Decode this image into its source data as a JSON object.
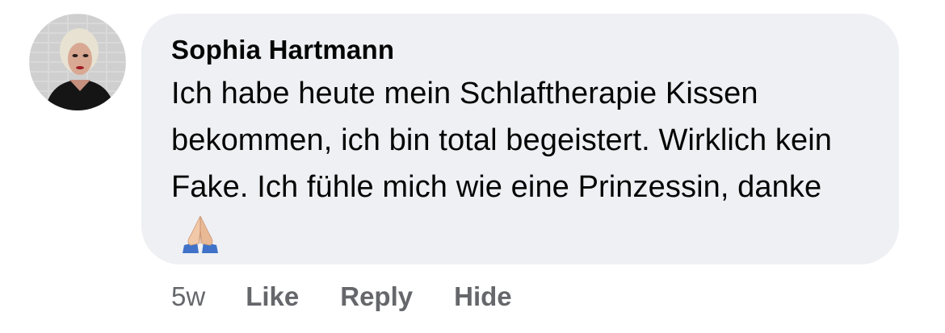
{
  "comment": {
    "author": "Sophia Hartmann",
    "text": "Ich habe heute mein Schlaftherapie Kissen bekommen, ich bin total begeistert. Wirklich kein Fake. Ich fühle mich wie eine Prinzessin, danke",
    "emoji": "folded-hands-icon",
    "timestamp": "5w",
    "actions": {
      "like": "Like",
      "reply": "Reply",
      "hide": "Hide"
    }
  },
  "colors": {
    "bubble_background": "#eff0f4",
    "text": "#050505",
    "secondary_text": "#65676b"
  }
}
